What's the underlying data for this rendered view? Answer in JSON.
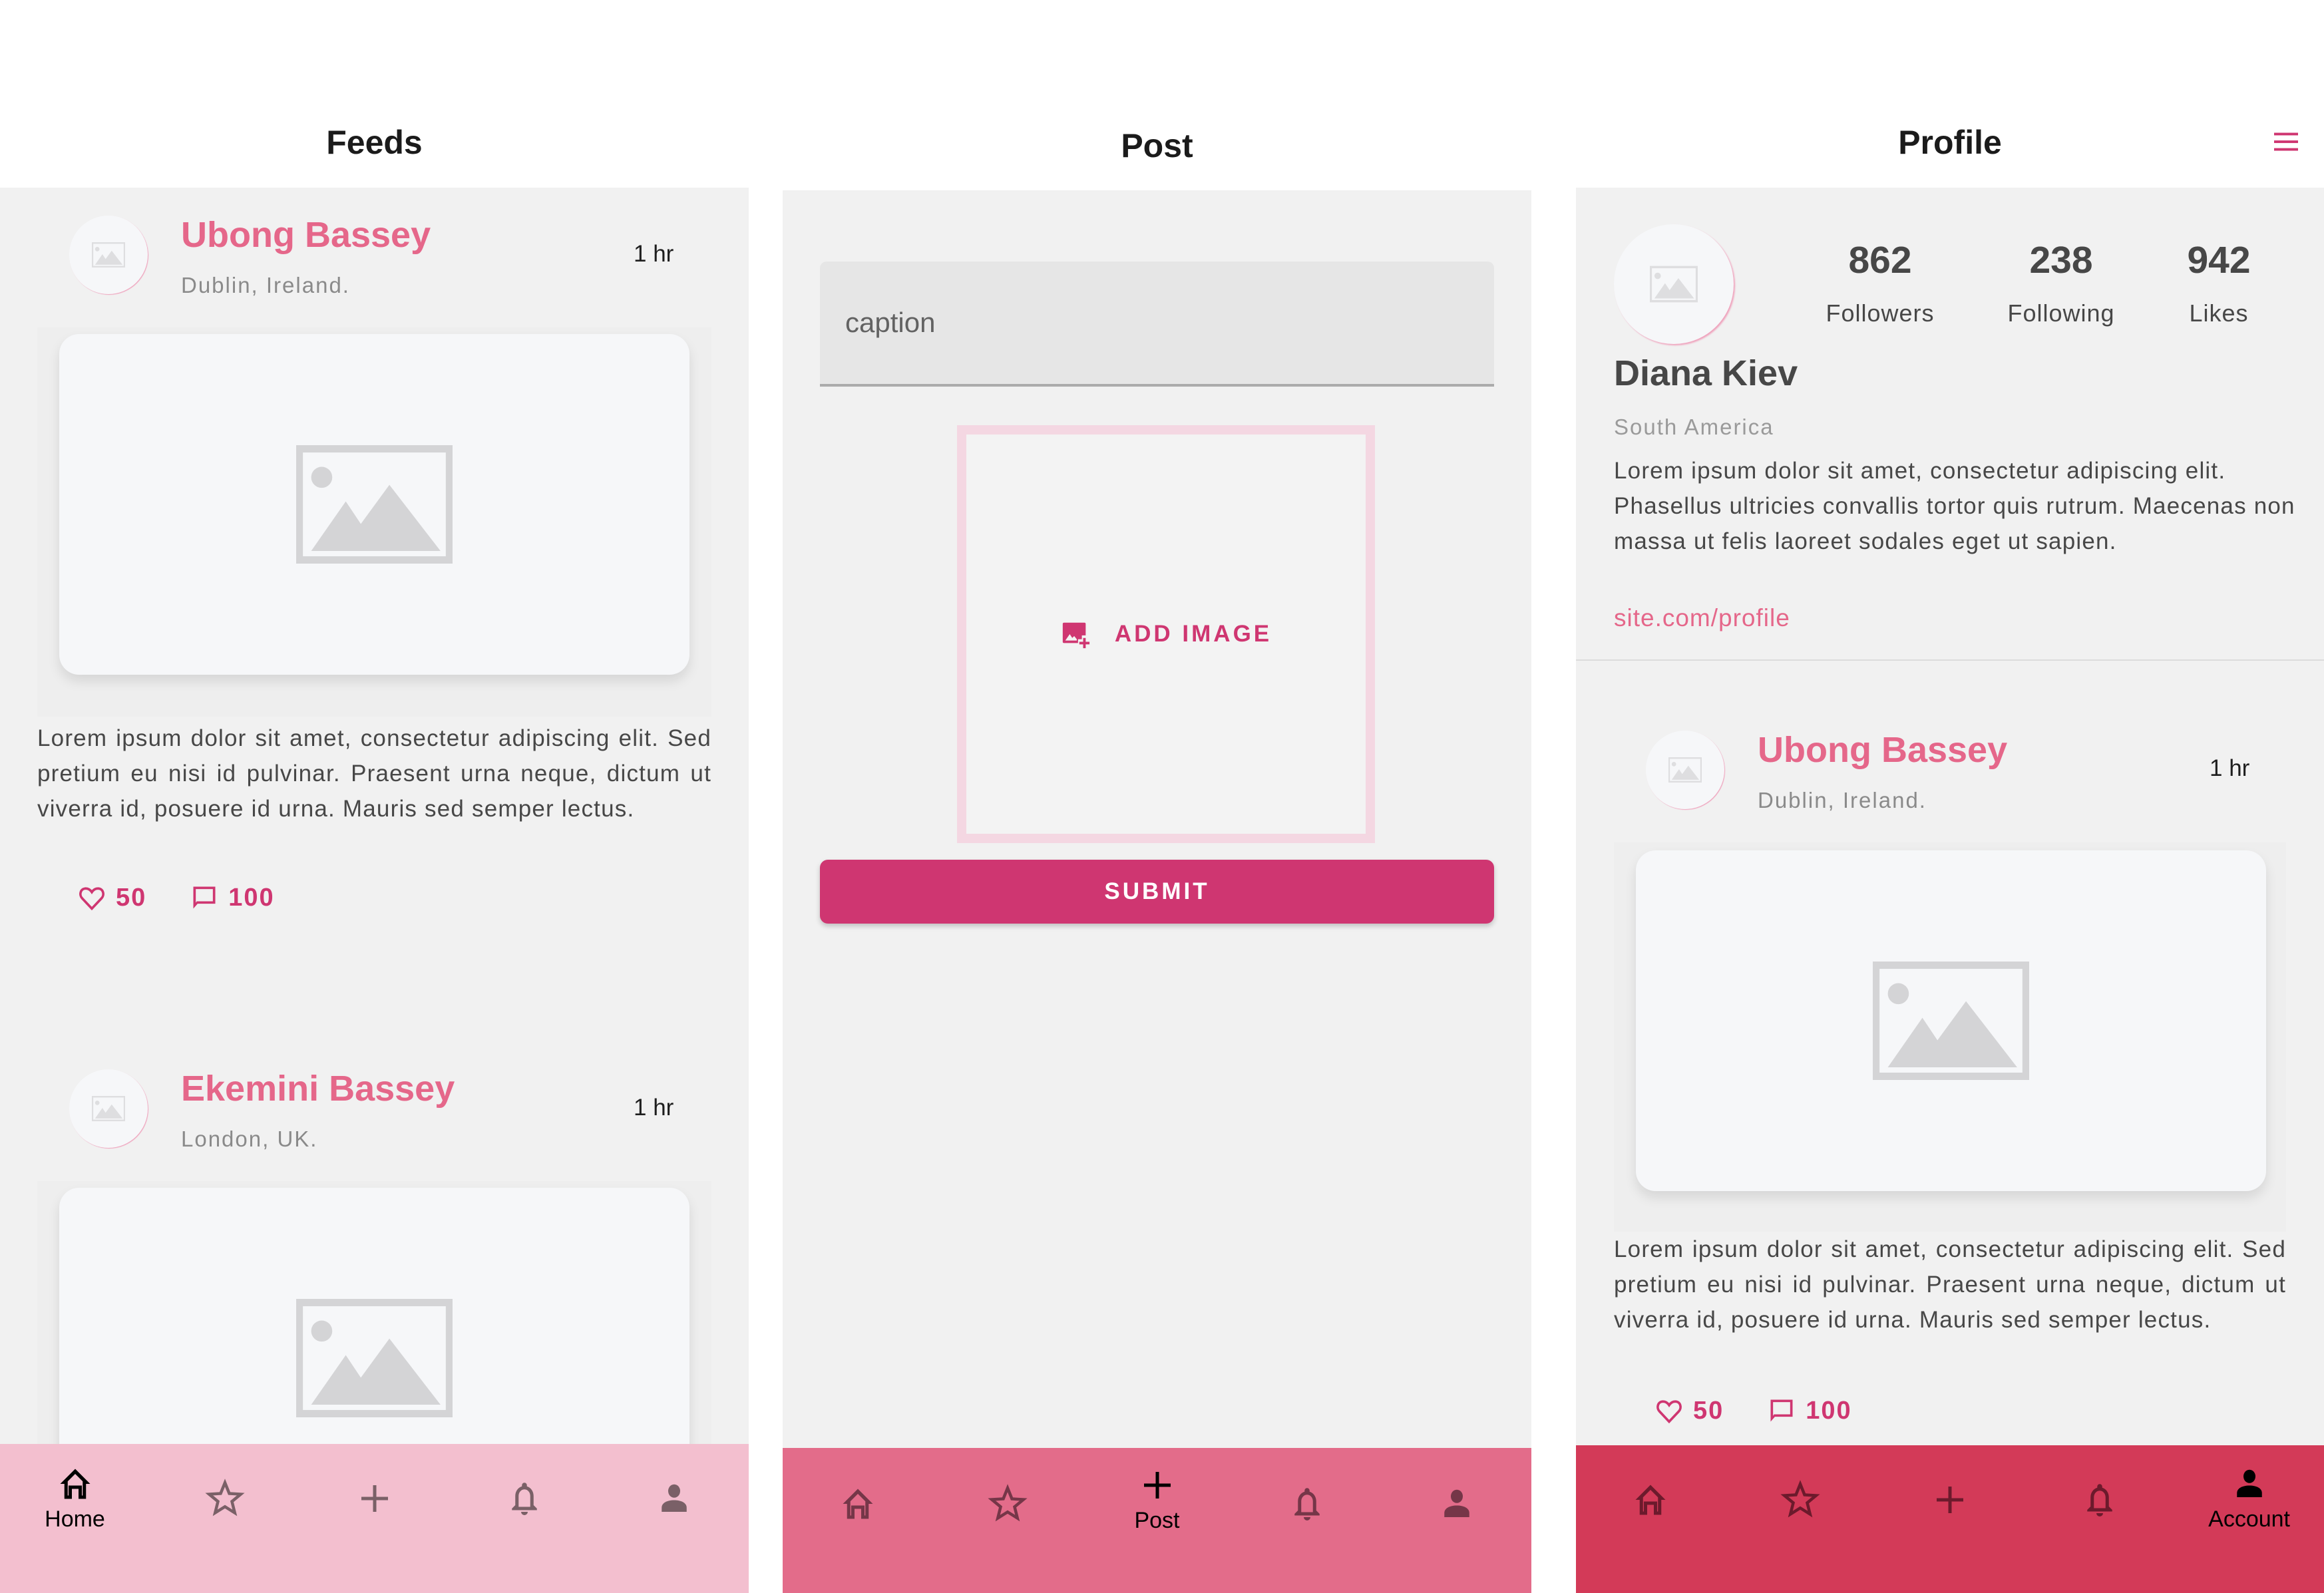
{
  "colors": {
    "accent": "#cf3671",
    "name_pink": "#e5678a",
    "nav_feeds": "#f3bfcf",
    "nav_post": "#e36c8a",
    "nav_profile": "#d33a58"
  },
  "feeds": {
    "title": "Feeds",
    "posts": [
      {
        "name": "Ubong Bassey",
        "location": "Dublin, Ireland.",
        "time": "1 hr",
        "text": "Lorem ipsum dolor sit amet, consectetur adipiscing elit. Sed pretium eu nisi id pulvinar. Praesent urna neque, dictum ut viverra id, posuere id urna. Mauris sed semper lectus.",
        "likes": "50",
        "comments": "100"
      },
      {
        "name": "Ekemini Bassey",
        "location": "London, UK.",
        "time": "1 hr"
      }
    ],
    "nav": [
      {
        "icon": "home-icon",
        "label": "Home",
        "active": true
      },
      {
        "icon": "star-icon",
        "label": "",
        "active": false
      },
      {
        "icon": "plus-icon",
        "label": "",
        "active": false
      },
      {
        "icon": "bell-icon",
        "label": "",
        "active": false
      },
      {
        "icon": "person-icon",
        "label": "",
        "active": false
      }
    ]
  },
  "post": {
    "title": "Post",
    "caption_placeholder": "caption",
    "caption_value": "",
    "add_image_label": "ADD IMAGE",
    "submit_label": "SUBMIT",
    "nav": [
      {
        "icon": "home-icon",
        "label": "",
        "active": false
      },
      {
        "icon": "star-icon",
        "label": "",
        "active": false
      },
      {
        "icon": "plus-icon",
        "label": "Post",
        "active": true
      },
      {
        "icon": "bell-icon",
        "label": "",
        "active": false
      },
      {
        "icon": "person-icon",
        "label": "",
        "active": false
      }
    ]
  },
  "profile": {
    "title": "Profile",
    "stats": [
      {
        "value": "862",
        "label": "Followers"
      },
      {
        "value": "238",
        "label": "Following"
      },
      {
        "value": "942",
        "label": "Likes"
      }
    ],
    "name": "Diana Kiev",
    "location": "South America",
    "bio": "Lorem ipsum dolor sit amet, consectetur adipiscing elit. Phasellus ultricies convallis tortor quis rutrum. Maecenas non massa ut felis laoreet sodales eget ut sapien.",
    "link": "site.com/profile",
    "post": {
      "name": "Ubong Bassey",
      "location": "Dublin, Ireland.",
      "time": "1 hr",
      "text": "Lorem ipsum dolor sit amet, consectetur adipiscing elit. Sed pretium eu nisi id pulvinar. Praesent urna neque, dictum ut viverra id, posuere id urna. Mauris sed semper lectus.",
      "likes": "50",
      "comments": "100"
    },
    "nav": [
      {
        "icon": "home-icon",
        "label": "",
        "active": false
      },
      {
        "icon": "star-icon",
        "label": "",
        "active": false
      },
      {
        "icon": "plus-icon",
        "label": "",
        "active": false
      },
      {
        "icon": "bell-icon",
        "label": "",
        "active": false
      },
      {
        "icon": "person-icon",
        "label": "Account",
        "active": true
      }
    ]
  }
}
